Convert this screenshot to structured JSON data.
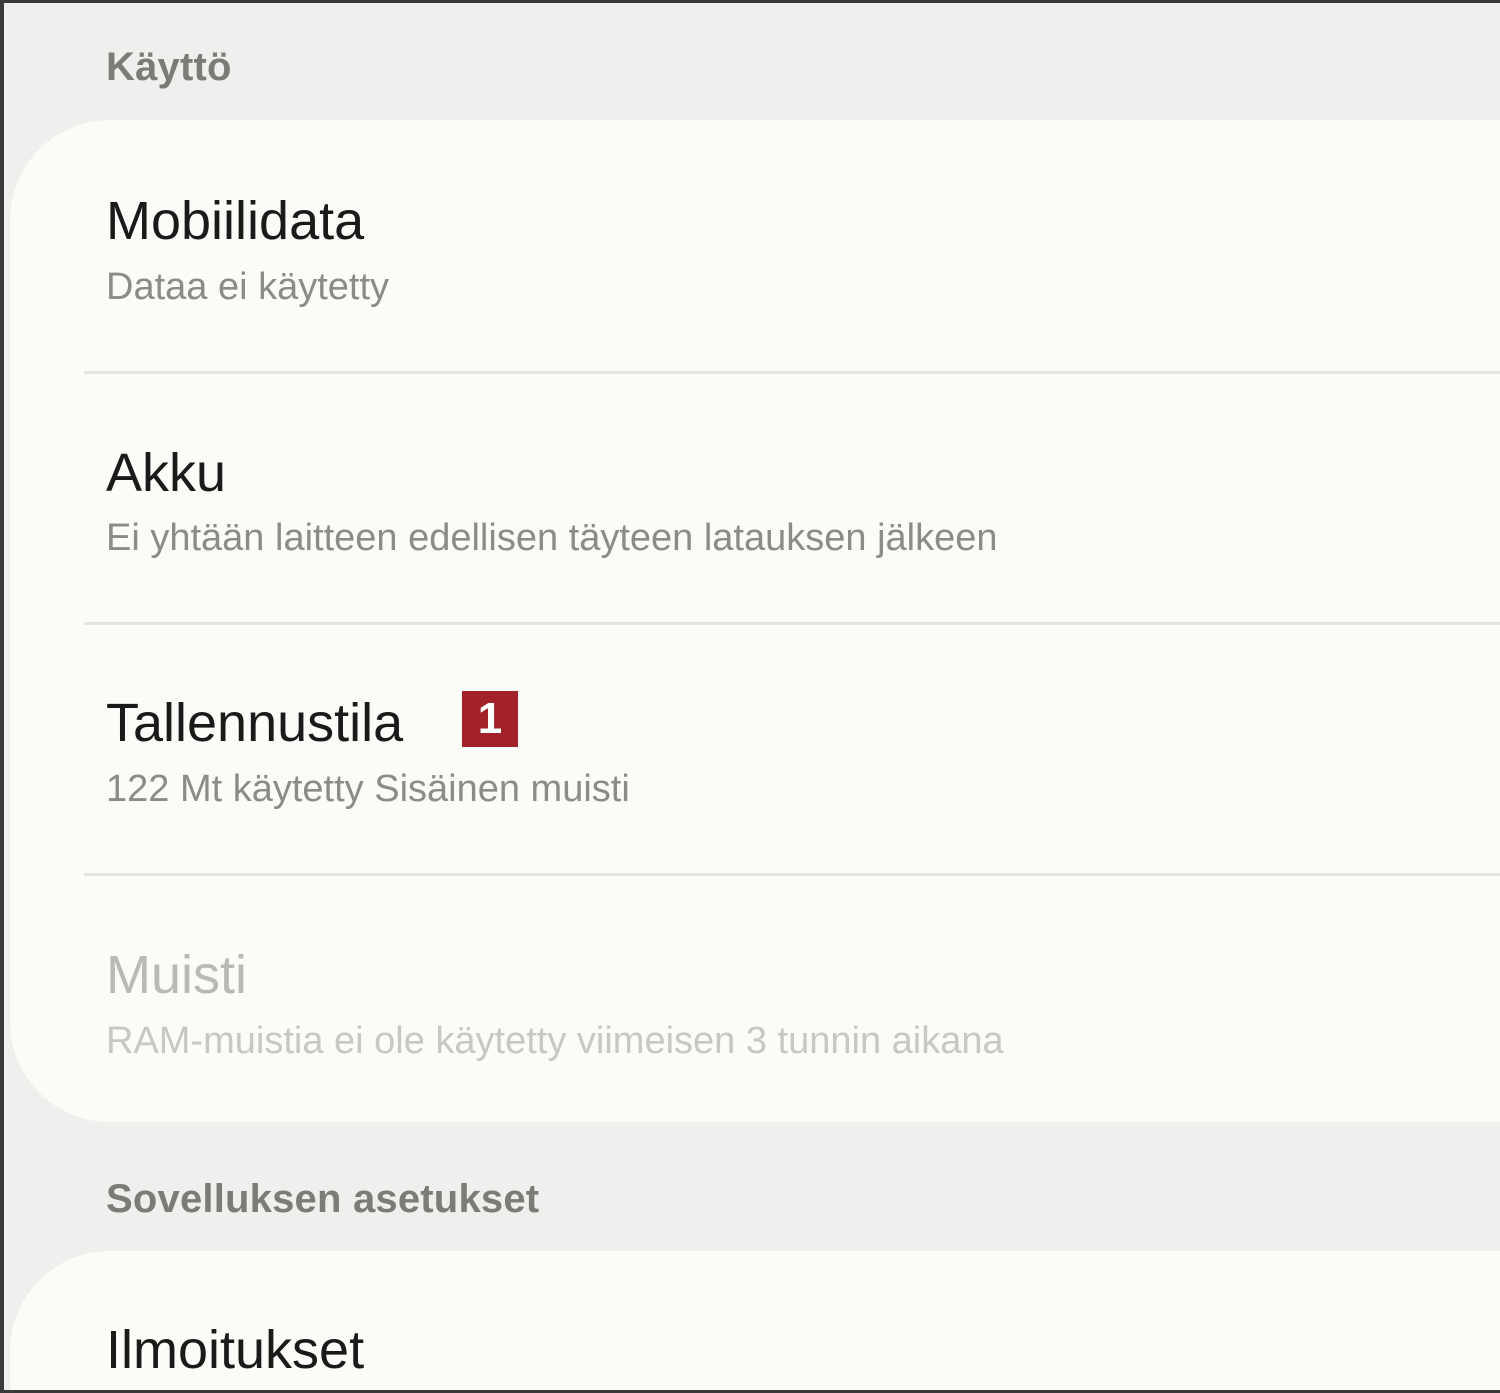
{
  "sections": {
    "usage": {
      "header": "Käyttö",
      "items": [
        {
          "title": "Mobiilidata",
          "subtitle": "Dataa ei käytetty"
        },
        {
          "title": "Akku",
          "subtitle": "Ei yhtään laitteen edellisen täyteen latauksen jälkeen"
        },
        {
          "title": "Tallennustila",
          "subtitle": "122 Mt käytetty Sisäinen muisti",
          "badge": "1"
        },
        {
          "title": "Muisti",
          "subtitle": "RAM-muistia ei ole käytetty viimeisen 3 tunnin aikana",
          "disabled": true
        }
      ]
    },
    "app_settings": {
      "header": "Sovelluksen asetukset",
      "items": [
        {
          "title": "Ilmoitukset"
        }
      ]
    }
  },
  "colors": {
    "background": "#efefed",
    "card": "#fbfbf8",
    "badge": "#a3212a"
  }
}
